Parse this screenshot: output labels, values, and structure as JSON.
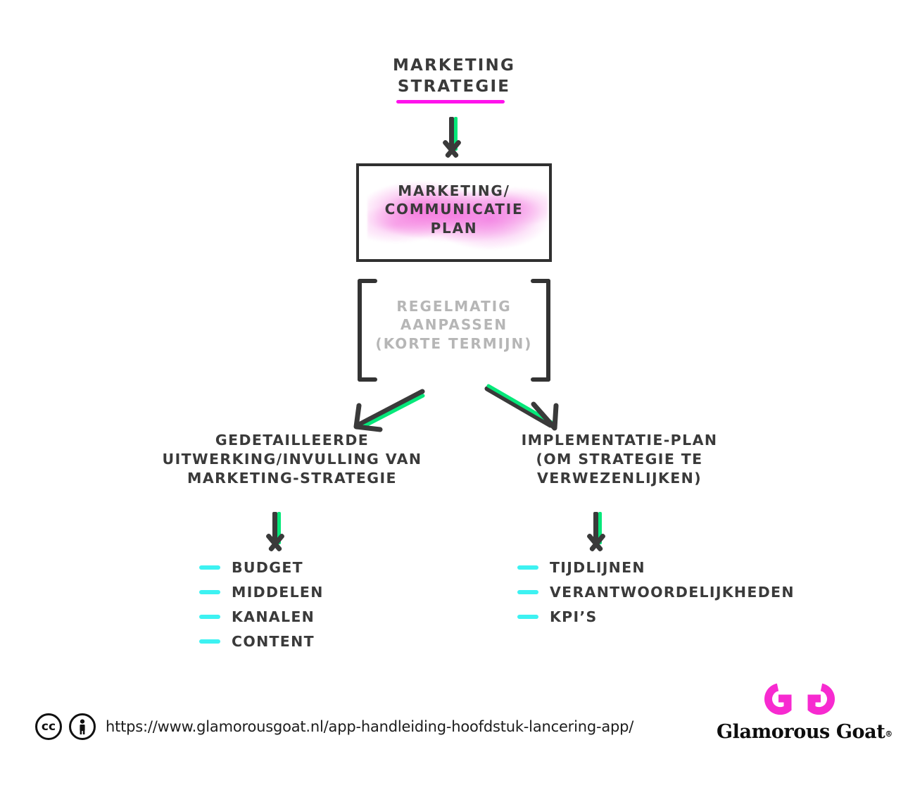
{
  "title": {
    "text": "MARKETING\nSTRATEGIE",
    "underline_color": "#ff12ec"
  },
  "plan_box": {
    "text": "MARKETING/\nCOMMUNICATIE\nPLAN",
    "highlight_color": "#f680e2",
    "border_color": "#303030"
  },
  "bracket_note": {
    "text": "REGELMATIG\nAANPASSEN\n(KORTE TERMIJN)",
    "color": "#b6b6b6"
  },
  "branches": {
    "left": {
      "heading": "GEDETAILLEERDE\nUITWERKING/INVULLING VAN\nMARKETING-STRATEGIE",
      "items": [
        {
          "label": "BUDGET"
        },
        {
          "label": "MIDDELEN"
        },
        {
          "label": "KANALEN"
        },
        {
          "label": "CONTENT"
        }
      ]
    },
    "right": {
      "heading": "IMPLEMENTATIE-PLAN\n(OM STRATEGIE TE\nVERWEZENLIJKEN)",
      "items": [
        {
          "label": "TIJDLIJNEN"
        },
        {
          "label": "VERANTWOORDELIJKHEDEN"
        },
        {
          "label": "KPI’S"
        }
      ]
    }
  },
  "arrows": {
    "dark_color": "#3a3a3a",
    "accent_color": "#06e87a"
  },
  "bullets": {
    "dash_color": "#3df2f2"
  },
  "footer": {
    "license_icons": [
      {
        "name": "creative-commons-icon",
        "glyph": "cc"
      },
      {
        "name": "attribution-icon",
        "glyph": "\u0000"
      }
    ],
    "cc_label": "cc",
    "url": "https://www.glamorousgoat.nl/app-handleiding-hoofdstuk-lancering-app/"
  },
  "logo": {
    "wordmark": "Glamorous Goat",
    "registered_mark": "®",
    "mark_color": "#f72ad0"
  }
}
